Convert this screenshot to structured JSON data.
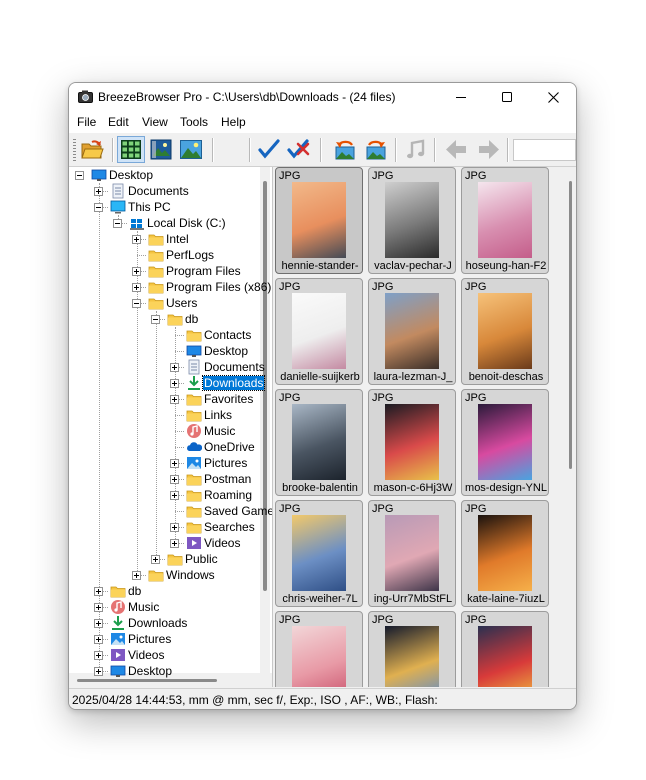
{
  "window": {
    "title": "BreezeBrowser Pro - C:\\Users\\db\\Downloads - (24 files)"
  },
  "menu": [
    {
      "label": "File"
    },
    {
      "label": "Edit"
    },
    {
      "label": "View"
    },
    {
      "label": "Tools"
    },
    {
      "label": "Help"
    }
  ],
  "toolbar": [
    {
      "icon": "open-folder-icon"
    },
    {
      "icon": "thumbnail-view-icon",
      "pressed": true
    },
    {
      "icon": "thumbnail-detail-view-icon"
    },
    {
      "icon": "image-view-icon"
    },
    {
      "icon": "tag-checkmark-icon"
    },
    {
      "icon": "untag-checkmark-icon"
    },
    {
      "icon": "rotate-left-icon"
    },
    {
      "icon": "rotate-right-icon"
    },
    {
      "icon": "music-note-icon"
    },
    {
      "icon": "back-arrow-icon"
    },
    {
      "icon": "forward-arrow-icon"
    }
  ],
  "tree": [
    {
      "label": "Desktop",
      "icon": "desktop-icon",
      "depth": 0,
      "expander": "minus"
    },
    {
      "label": "Documents",
      "icon": "documents-icon",
      "depth": 1,
      "expander": "plus"
    },
    {
      "label": "This PC",
      "icon": "computer-icon",
      "depth": 1,
      "expander": "minus"
    },
    {
      "label": "Local Disk (C:)",
      "icon": "drive-icon",
      "depth": 2,
      "expander": "minus"
    },
    {
      "label": "Intel",
      "icon": "folder-icon",
      "depth": 3,
      "expander": "plus"
    },
    {
      "label": "PerfLogs",
      "icon": "folder-icon",
      "depth": 3,
      "expander": "none"
    },
    {
      "label": "Program Files",
      "icon": "folder-icon",
      "depth": 3,
      "expander": "plus"
    },
    {
      "label": "Program Files (x86)",
      "icon": "folder-icon",
      "depth": 3,
      "expander": "plus"
    },
    {
      "label": "Users",
      "icon": "folder-icon",
      "depth": 3,
      "expander": "minus"
    },
    {
      "label": "db",
      "icon": "folder-icon",
      "depth": 4,
      "expander": "minus"
    },
    {
      "label": "Contacts",
      "icon": "folder-icon",
      "depth": 5,
      "expander": "none"
    },
    {
      "label": "Desktop",
      "icon": "desktop-icon",
      "depth": 5,
      "expander": "none"
    },
    {
      "label": "Documents",
      "icon": "documents-icon",
      "depth": 5,
      "expander": "plus"
    },
    {
      "label": "Downloads",
      "icon": "downloads-icon",
      "depth": 5,
      "expander": "plus",
      "selected": true
    },
    {
      "label": "Favorites",
      "icon": "folder-icon",
      "depth": 5,
      "expander": "plus"
    },
    {
      "label": "Links",
      "icon": "folder-icon",
      "depth": 5,
      "expander": "none"
    },
    {
      "label": "Music",
      "icon": "music-icon",
      "depth": 5,
      "expander": "none"
    },
    {
      "label": "OneDrive",
      "icon": "onedrive-icon",
      "depth": 5,
      "expander": "none"
    },
    {
      "label": "Pictures",
      "icon": "pictures-icon",
      "depth": 5,
      "expander": "plus"
    },
    {
      "label": "Postman",
      "icon": "folder-icon",
      "depth": 5,
      "expander": "plus"
    },
    {
      "label": "Roaming",
      "icon": "folder-icon",
      "depth": 5,
      "expander": "plus"
    },
    {
      "label": "Saved Games",
      "icon": "folder-icon",
      "depth": 5,
      "expander": "none"
    },
    {
      "label": "Searches",
      "icon": "folder-icon",
      "depth": 5,
      "expander": "plus"
    },
    {
      "label": "Videos",
      "icon": "videos-icon",
      "depth": 5,
      "expander": "plus"
    },
    {
      "label": "Public",
      "icon": "folder-icon",
      "depth": 4,
      "expander": "plus"
    },
    {
      "label": "Windows",
      "icon": "folder-icon",
      "depth": 3,
      "expander": "plus"
    },
    {
      "label": "db",
      "icon": "folder-icon",
      "depth": 1,
      "expander": "plus"
    },
    {
      "label": "Music",
      "icon": "music-icon",
      "depth": 1,
      "expander": "plus"
    },
    {
      "label": "Downloads",
      "icon": "downloads-icon",
      "depth": 1,
      "expander": "plus"
    },
    {
      "label": "Pictures",
      "icon": "pictures-icon",
      "depth": 1,
      "expander": "plus"
    },
    {
      "label": "Videos",
      "icon": "videos-icon",
      "depth": 1,
      "expander": "plus"
    },
    {
      "label": "Desktop",
      "icon": "desktop-icon",
      "depth": 1,
      "expander": "plus"
    }
  ],
  "thumbnails": [
    {
      "type": "JPG",
      "name": "hennie-stander-",
      "orientation": "landscape",
      "colors": [
        "#f2b98a",
        "#e88f5e",
        "#444a55"
      ],
      "selected": true
    },
    {
      "type": "JPG",
      "name": "vaclav-pechar-J",
      "orientation": "portrait",
      "colors": [
        "#cfcfcf",
        "#7a7a7a",
        "#2a2a2a"
      ]
    },
    {
      "type": "JPG",
      "name": "hoseung-han-F2",
      "orientation": "landscape",
      "colors": [
        "#f5e6ee",
        "#d88fb0",
        "#c45d8a"
      ]
    },
    {
      "type": "JPG",
      "name": "danielle-suijkerb",
      "orientation": "portrait",
      "colors": [
        "#fafafa",
        "#eeeeee",
        "#c48aa2"
      ]
    },
    {
      "type": "JPG",
      "name": "laura-lezman-J_",
      "orientation": "portrait",
      "colors": [
        "#7ea0c8",
        "#c28a60",
        "#3a2e28"
      ]
    },
    {
      "type": "JPG",
      "name": "benoit-deschas",
      "orientation": "portrait",
      "colors": [
        "#f6c27a",
        "#d8883a",
        "#6a3a1a"
      ]
    },
    {
      "type": "JPG",
      "name": "brooke-balentin",
      "orientation": "portrait",
      "colors": [
        "#a9b7c6",
        "#4a5562",
        "#1c232c"
      ]
    },
    {
      "type": "JPG",
      "name": "mason-c-6Hj3W",
      "orientation": "portrait",
      "colors": [
        "#1a1b22",
        "#d94a4a",
        "#e8c24a"
      ]
    },
    {
      "type": "JPG",
      "name": "mos-design-YNL",
      "orientation": "portrait",
      "colors": [
        "#2a1a3a",
        "#d84aa0",
        "#49a4e0"
      ]
    },
    {
      "type": "JPG",
      "name": "chris-weiher-7L",
      "orientation": "portrait",
      "colors": [
        "#f3c96a",
        "#6c8fc4",
        "#2f4f86"
      ]
    },
    {
      "type": "JPG",
      "name": "ing-Urr7MbStFL",
      "orientation": "portrait",
      "colors": [
        "#b89ab6",
        "#e0a8b4",
        "#3d3448"
      ]
    },
    {
      "type": "JPG",
      "name": "kate-laine-7iuzL",
      "orientation": "portrait",
      "colors": [
        "#1a120e",
        "#e07a2a",
        "#f6b04a"
      ]
    },
    {
      "type": "JPG",
      "name": "",
      "orientation": "portrait",
      "colors": [
        "#f2d6d8",
        "#e89aa6",
        "#c8506a"
      ]
    },
    {
      "type": "JPG",
      "name": "",
      "orientation": "portrait",
      "colors": [
        "#141a2c",
        "#e0b050",
        "#5a8ad0"
      ]
    },
    {
      "type": "JPG",
      "name": "",
      "orientation": "portrait",
      "colors": [
        "#2a3050",
        "#d83a3a",
        "#f0c040"
      ]
    }
  ],
  "status": {
    "text": "2025/04/28 14:44:53, mm @ mm, sec f/, Exp:, ISO , AF:, WB:, Flash:"
  },
  "colors": {
    "selection": "#0078d7",
    "folder": "#f5c542",
    "check_blue": "#1565c0",
    "check_red": "#d32f2f"
  }
}
